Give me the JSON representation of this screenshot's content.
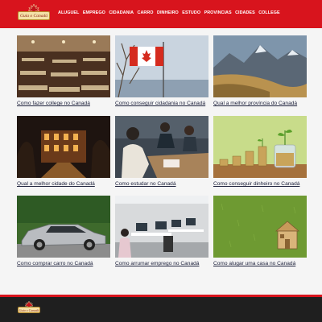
{
  "header": {
    "logo_text": "Guia o Canadá",
    "nav": [
      "ALUGUEL",
      "EMPREGO",
      "CIDADANIA",
      "CARRO",
      "DINHEIRO",
      "ESTUDO",
      "PROVINCIAS",
      "CIDADES",
      "COLLEGE"
    ]
  },
  "articles": [
    {
      "title": "Como fazer college no Canadá"
    },
    {
      "title": "Como conseguir cidadania no Canadá"
    },
    {
      "title": "Qual a melhor província do Canadá"
    },
    {
      "title": "Qual a melhor cidade do Canadá"
    },
    {
      "title": "Como estudar no Canadá"
    },
    {
      "title": "Como conseguir dinheiro no Canadá"
    },
    {
      "title": "Como comprar carro no Canadá"
    },
    {
      "title": "Como arrumar emprego no Canadá"
    },
    {
      "title": "Como alugar uma casa no Canadá"
    }
  ],
  "footer": {
    "logo_text": "Guia o Canadá"
  },
  "colors": {
    "brand_red": "#d8141d",
    "footer_dark": "#1f1f1f",
    "link": "#1b1f3a"
  },
  "icons": [
    "maple-leaf-icon"
  ]
}
